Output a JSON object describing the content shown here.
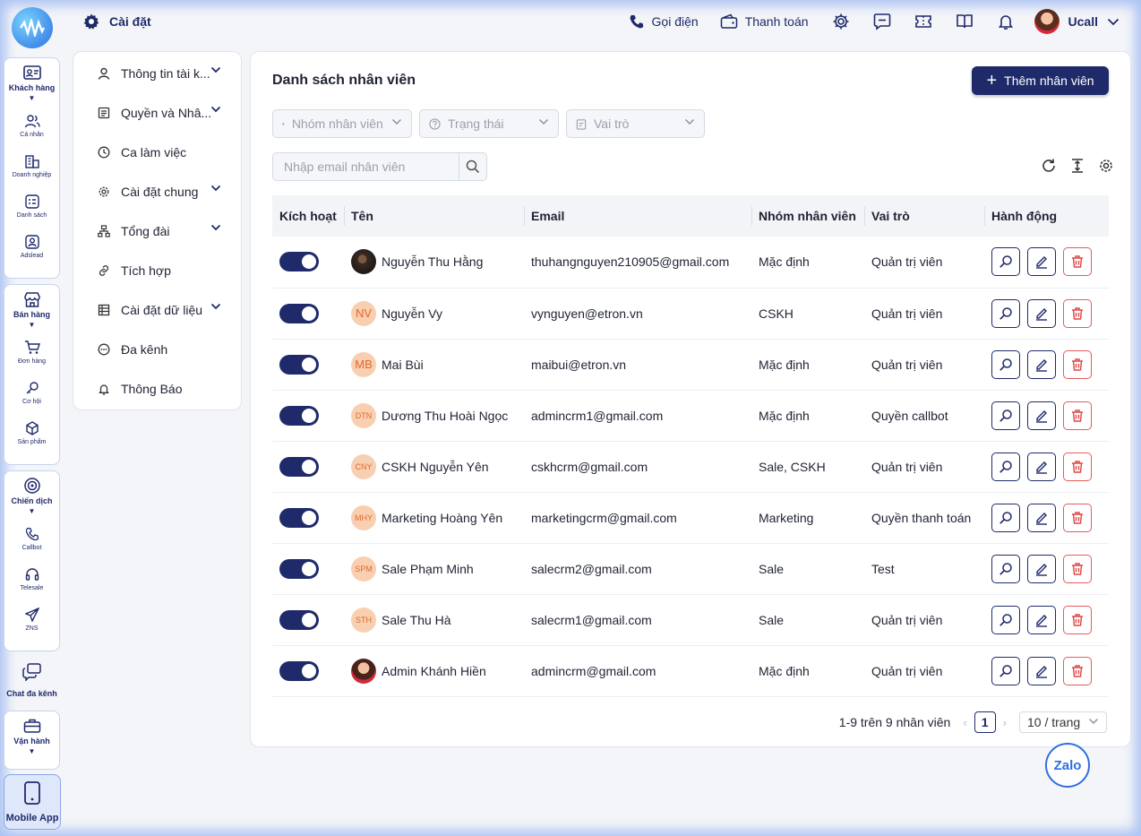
{
  "rail": {
    "logo": "logo-icon",
    "groups": [
      {
        "label": "Khách hàng",
        "items": [
          {
            "label": "Cá nhân"
          },
          {
            "label": "Doanh nghiệp"
          },
          {
            "label": "Danh sách"
          },
          {
            "label": "Adslead"
          }
        ]
      },
      {
        "label": "Bán hàng",
        "items": [
          {
            "label": "Đơn hàng"
          },
          {
            "label": "Cơ hội"
          },
          {
            "label": "Sản phẩm"
          }
        ]
      },
      {
        "label": "Chiến dịch",
        "items": [
          {
            "label": "Callbot"
          },
          {
            "label": "Telesale"
          },
          {
            "label": "ZNS"
          }
        ]
      }
    ],
    "chat": "Chat đa kênh",
    "ops": "Vận hành",
    "mobile": "Mobile App"
  },
  "topbar": {
    "title": "Cài đặt",
    "call": "Gọi điện",
    "payment": "Thanh toán",
    "user": "Ucall"
  },
  "menu": [
    {
      "label": "Thông tin tài k...",
      "caret": true
    },
    {
      "label": "Quyền và Nhâ...",
      "caret": true
    },
    {
      "label": "Ca làm việc",
      "caret": false
    },
    {
      "label": "Cài đặt chung",
      "caret": true
    },
    {
      "label": "Tổng đài",
      "caret": true
    },
    {
      "label": "Tích hợp",
      "caret": false
    },
    {
      "label": "Cài đặt dữ liệu",
      "caret": true
    },
    {
      "label": "Đa kênh",
      "caret": false
    },
    {
      "label": "Thông Báo",
      "caret": false
    }
  ],
  "main": {
    "title": "Danh sách nhân viên",
    "add_label": "Thêm nhân viên",
    "filters": {
      "group": "Nhóm nhân viên",
      "status": "Trạng thái",
      "role": "Vai trò"
    },
    "search_placeholder": "Nhập email nhân viên",
    "columns": [
      "Kích hoạt",
      "Tên",
      "Email",
      "Nhóm nhân viên",
      "Vai trò",
      "Hành động"
    ],
    "rows": [
      {
        "active": true,
        "initials": "",
        "name": "Nguyễn Thu Hằng",
        "email": "thuhangnguyen210905@gmail.com",
        "group": "Mặc định",
        "role": "Quản trị viên"
      },
      {
        "active": true,
        "initials": "NV",
        "name": "Nguyễn Vy",
        "email": "vynguyen@etron.vn",
        "group": "CSKH",
        "role": "Quản trị viên"
      },
      {
        "active": true,
        "initials": "MB",
        "name": "Mai Bùi",
        "email": "maibui@etron.vn",
        "group": "Mặc định",
        "role": "Quản trị viên"
      },
      {
        "active": true,
        "initials": "DTN",
        "name": "Dương Thu Hoài Ngọc",
        "email": "admincrm1@gmail.com",
        "group": "Mặc định",
        "role": "Quyền callbot"
      },
      {
        "active": true,
        "initials": "CNY",
        "name": "CSKH Nguyễn Yên",
        "email": "cskhcrm@gmail.com",
        "group": "Sale, CSKH",
        "role": "Quản trị viên"
      },
      {
        "active": true,
        "initials": "MHY",
        "name": "Marketing Hoàng Yên",
        "email": "marketingcrm@gmail.com",
        "group": "Marketing",
        "role": "Quyền thanh toán"
      },
      {
        "active": true,
        "initials": "SPM",
        "name": "Sale Phạm Minh",
        "email": "salecrm2@gmail.com",
        "group": "Sale",
        "role": "Test"
      },
      {
        "active": true,
        "initials": "STH",
        "name": "Sale Thu Hà",
        "email": "salecrm1@gmail.com",
        "group": "Sale",
        "role": "Quản trị viên"
      },
      {
        "active": true,
        "initials": "",
        "name": "Admin Khánh Hiền",
        "email": "admincrm@gmail.com",
        "group": "Mặc định",
        "role": "Quản trị viên"
      }
    ],
    "pagination": {
      "summary": "1-9 trên 9 nhân viên",
      "page": "1",
      "size": "10 / trang"
    }
  },
  "zalo": "Zalo"
}
